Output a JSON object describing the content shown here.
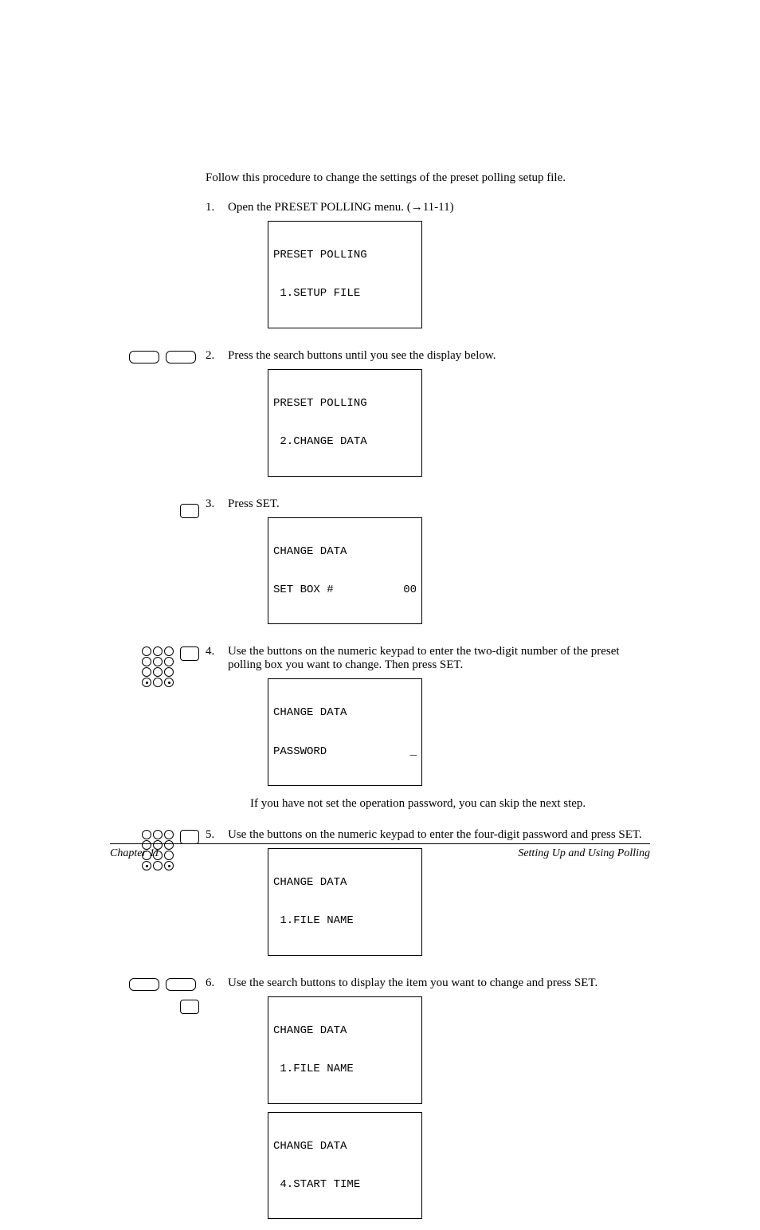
{
  "intro": "Follow this procedure to change the settings of the preset polling setup file.",
  "steps": {
    "s1": {
      "num": "1.",
      "text": "Open the PRESET POLLING menu. (→11-11)",
      "disp_l1": "PRESET POLLING",
      "disp_l2": " 1.SETUP FILE"
    },
    "s2": {
      "num": "2.",
      "text": "Press the search buttons until you see the display below.",
      "disp_l1": "PRESET POLLING",
      "disp_l2": " 2.CHANGE DATA"
    },
    "s3": {
      "num": "3.",
      "text": "Press SET.",
      "disp_l1": "CHANGE DATA",
      "disp_l2_left": "SET BOX #",
      "disp_l2_right": "00"
    },
    "s4": {
      "num": "4.",
      "text": "Use the buttons on the numeric keypad to enter the two-digit number of the preset polling box you want to change. Then press SET.",
      "disp_l1": "CHANGE DATA",
      "disp_l2_left": "PASSWORD",
      "disp_l2_right": "_"
    },
    "s4_note": "If you have not set the operation password, you can skip the next step.",
    "s5": {
      "num": "5.",
      "text": "Use the buttons on the numeric keypad to enter the four-digit password and press SET.",
      "disp_l1": "CHANGE DATA",
      "disp_l2": " 1.FILE NAME"
    },
    "s6": {
      "num": "6.",
      "text": "Use the search buttons to display the item you want to change and press SET.",
      "disp1_l1": "CHANGE DATA",
      "disp1_l2": " 1.FILE NAME",
      "disp2_l1": "CHANGE DATA",
      "disp2_l2": " 4.START TIME"
    }
  },
  "footer": {
    "left": "Chapter 11",
    "right": "Setting Up and Using Polling"
  }
}
